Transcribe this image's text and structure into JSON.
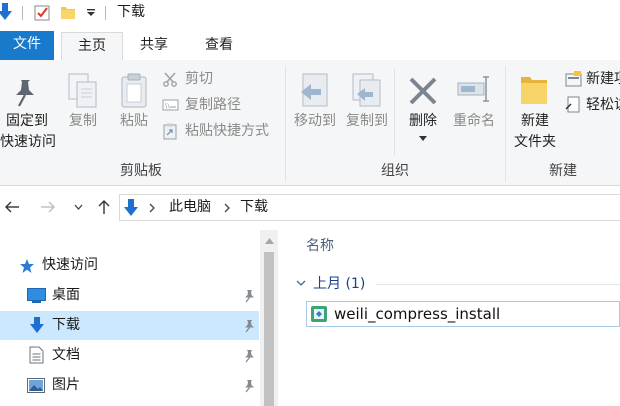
{
  "window": {
    "title": "下载"
  },
  "ribbon_tabs": [
    {
      "label": "文件"
    },
    {
      "label": "主页"
    },
    {
      "label": "共享"
    },
    {
      "label": "查看"
    }
  ],
  "clipboard": {
    "pin_line1": "固定到",
    "pin_line2": "快速访问",
    "copy": "复制",
    "paste": "粘贴",
    "cut": "剪切",
    "copy_path": "复制路径",
    "paste_shortcut": "粘贴快捷方式",
    "group_label": "剪贴板"
  },
  "organize": {
    "move_to": "移动到",
    "copy_to": "复制到",
    "delete": "删除",
    "rename": "重命名",
    "group_label": "组织"
  },
  "new_group": {
    "new_folder_line1": "新建",
    "new_folder_line2": "文件夹",
    "new_item": "新建项",
    "easy_access": "轻松访",
    "group_label": "新建"
  },
  "address": {
    "segments": [
      "此电脑",
      "下载"
    ]
  },
  "nav": {
    "quick_access": "快速访问",
    "items": [
      {
        "label": "桌面",
        "icon": "desktop-icon"
      },
      {
        "label": "下载",
        "icon": "download-icon",
        "selected": true
      },
      {
        "label": "文档",
        "icon": "document-icon"
      },
      {
        "label": "图片",
        "icon": "pictures-icon"
      }
    ]
  },
  "content": {
    "column_name": "名称",
    "group_header": "上月 (1)",
    "files": [
      {
        "name": "weili_compress_install"
      }
    ]
  },
  "colors": {
    "accent": "#1979ca",
    "selection": "#cce8ff"
  }
}
